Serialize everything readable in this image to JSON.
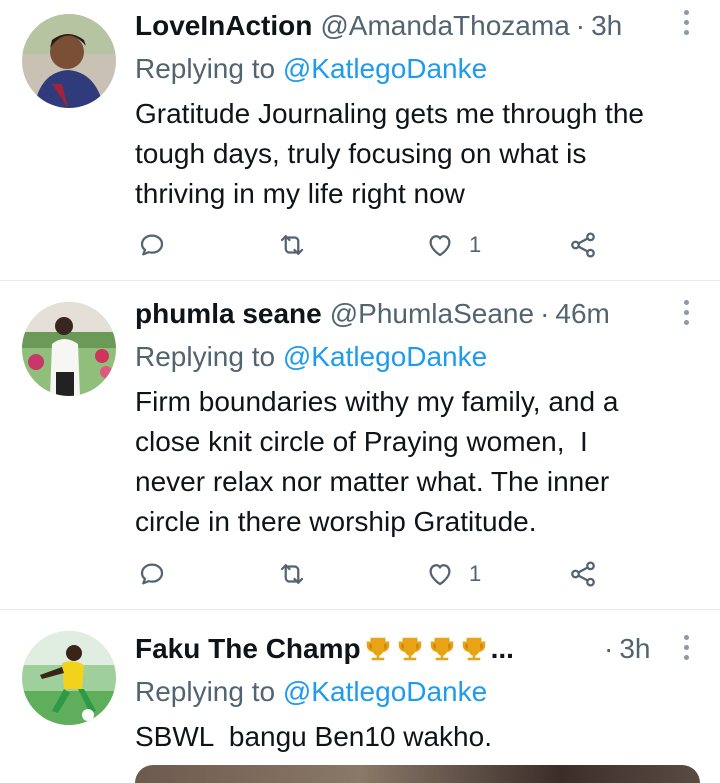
{
  "tweets": [
    {
      "display_name": "LoveInAction",
      "handle": "@AmandaThozama",
      "separator": "·",
      "time": "3h",
      "replying_prefix": "Replying to",
      "replying_to": "@KatlegoDanke",
      "text": "Gratitude Journaling gets me through the\ntough days, truly focusing on what is\nthriving in my life right now",
      "like_count": "1"
    },
    {
      "display_name": "phumla seane",
      "handle": "@PhumlaSeane",
      "separator": "·",
      "time": "46m",
      "replying_prefix": "Replying to",
      "replying_to": "@KatlegoDanke",
      "text": "Firm boundaries withy my family, and a\nclose knit circle of Praying women,  I\nnever relax nor matter what. The inner\ncircle in there worship Gratitude.",
      "like_count": "1"
    },
    {
      "display_name": "Faku The Champ",
      "name_suffix": "...",
      "separator": "·",
      "time": "3h",
      "replying_prefix": "Replying to",
      "replying_to": "@KatlegoDanke",
      "text": "SBWL  bangu Ben10 wakho."
    }
  ],
  "icons": {
    "reply": "reply-icon",
    "retweet": "retweet-icon",
    "like": "heart-icon",
    "share": "share-icon",
    "more": "more-options-icon",
    "trophy": "trophy-icon"
  },
  "colors": {
    "text": "#0f1419",
    "secondary": "#536471",
    "link": "#1d9bf0",
    "icon": "#536471",
    "trophy": "#e8a317"
  }
}
